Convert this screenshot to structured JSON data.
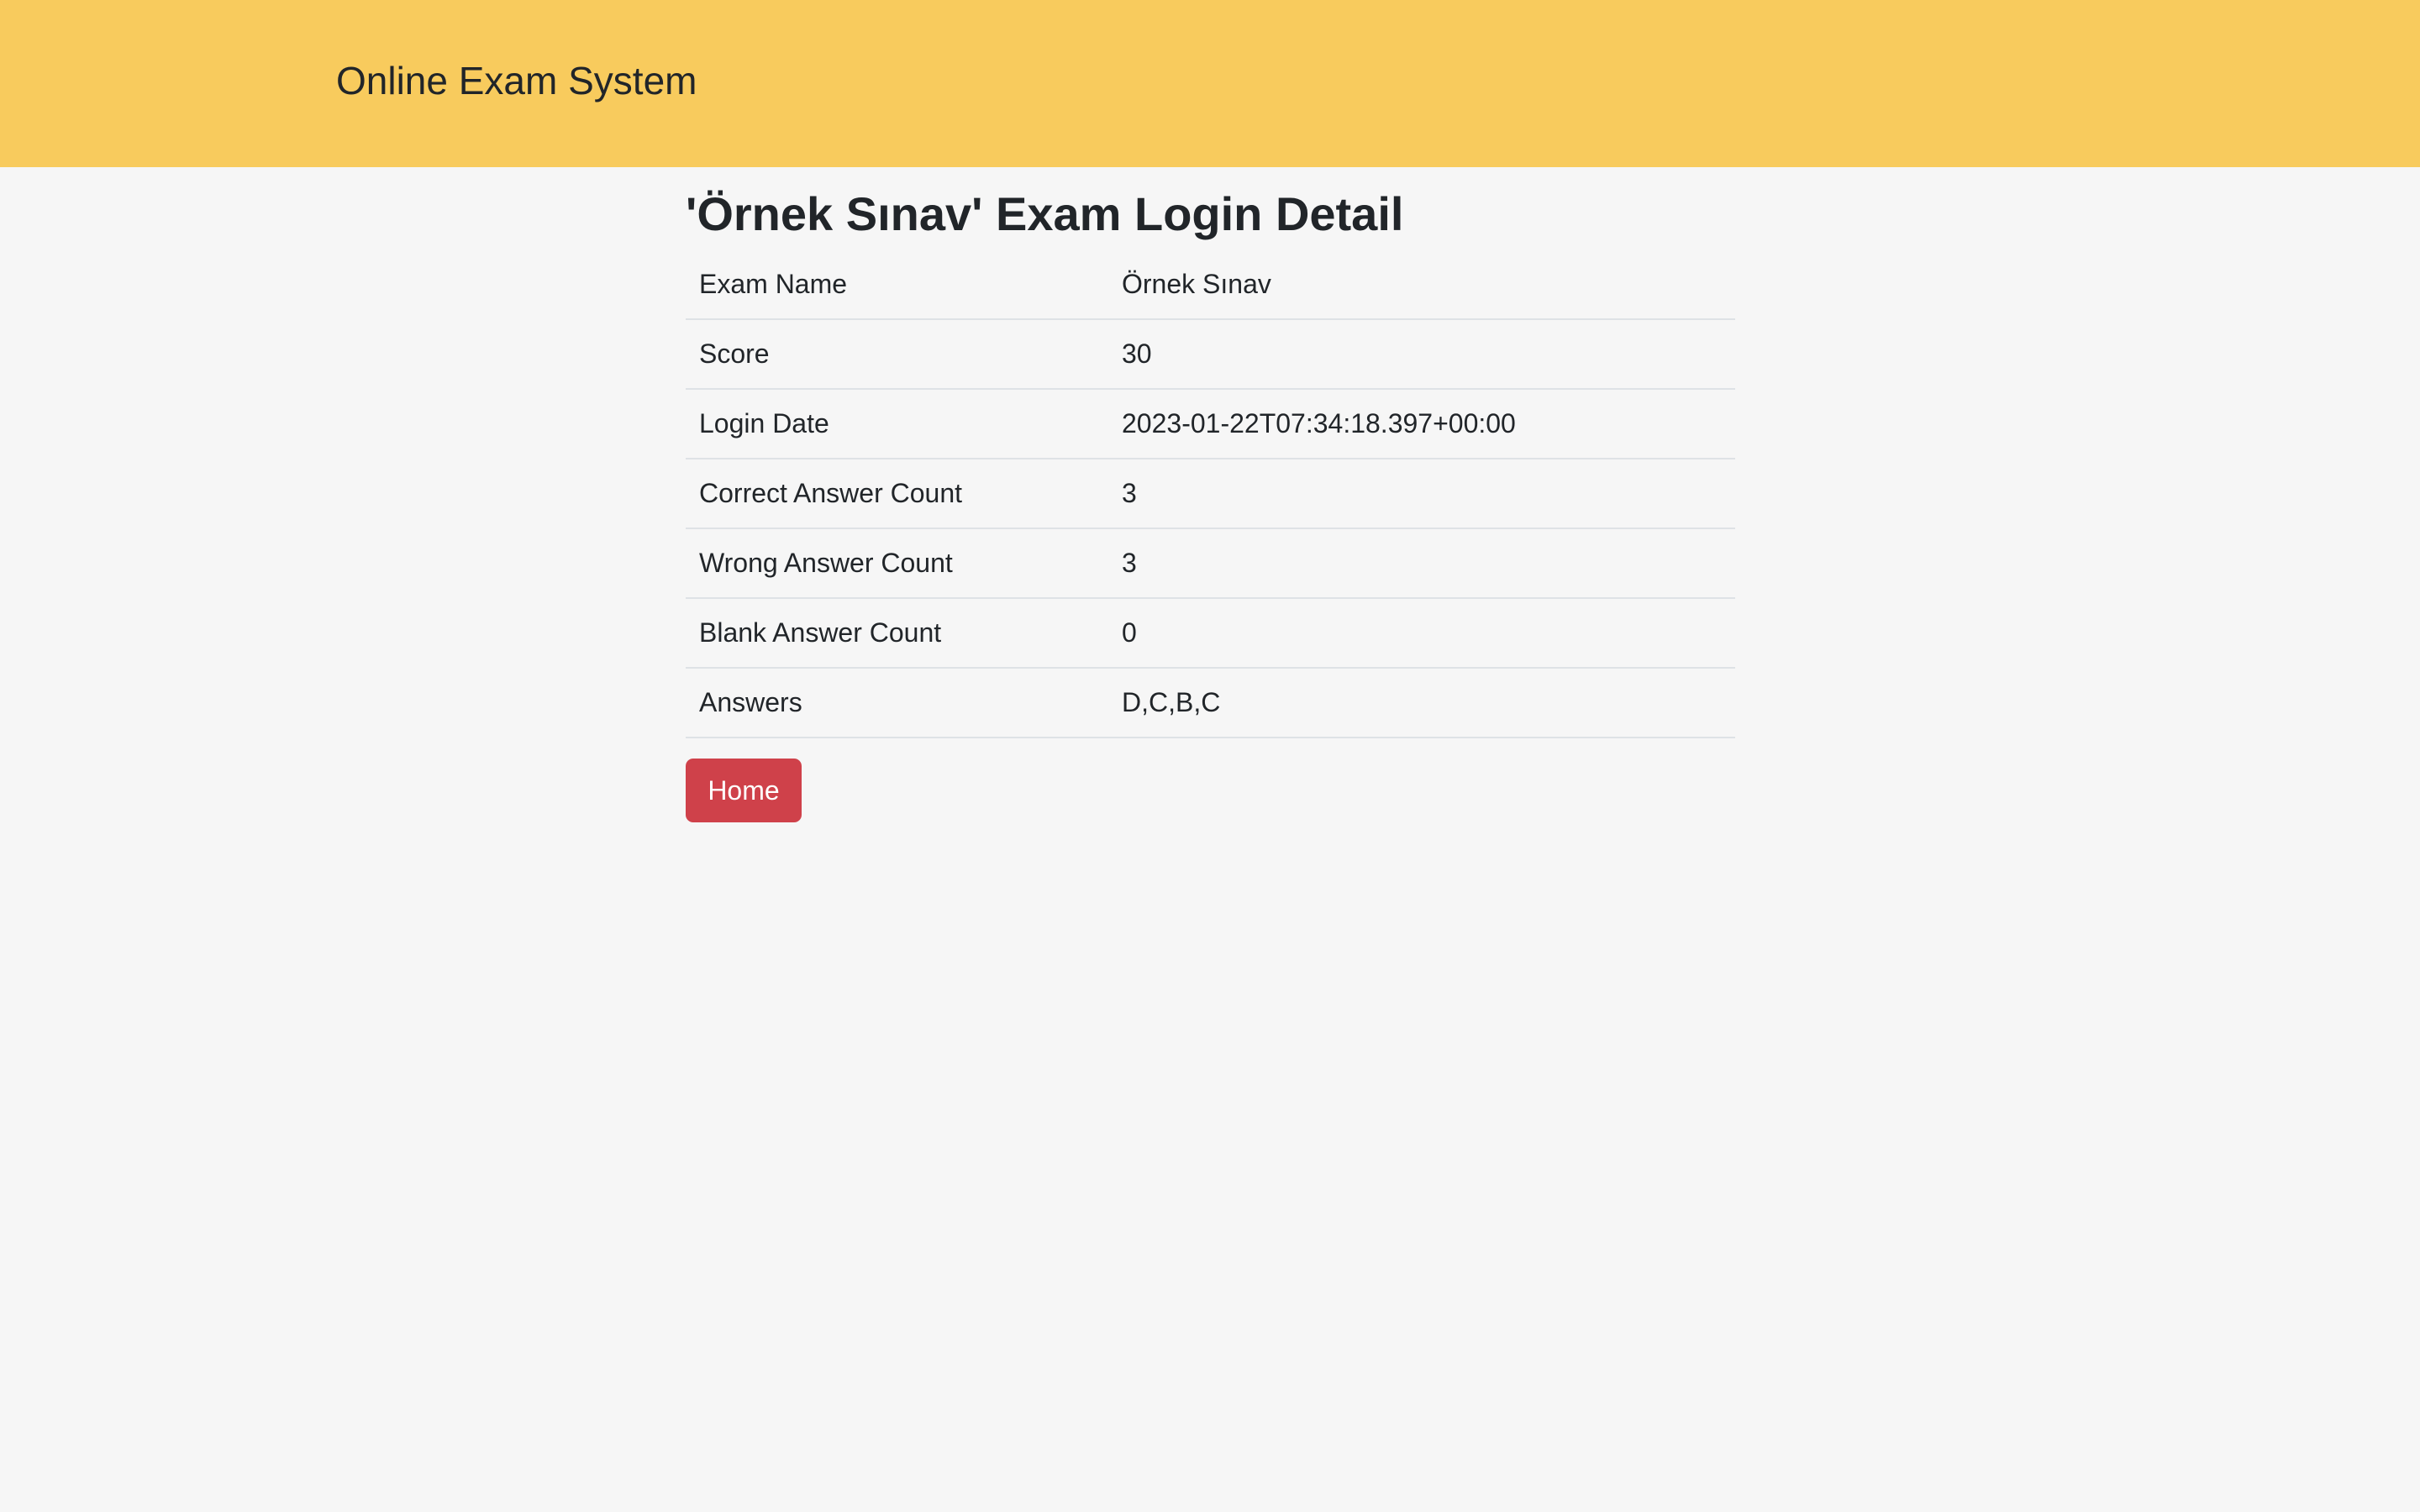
{
  "navbar": {
    "brand": "Online Exam System",
    "color": "#f8cb5d"
  },
  "page": {
    "title": "'Örnek Sınav' Exam Login Detail"
  },
  "details": {
    "rows": [
      {
        "label": "Exam Name",
        "value": "Örnek Sınav"
      },
      {
        "label": "Score",
        "value": "30"
      },
      {
        "label": "Login Date",
        "value": "2023-01-22T07:34:18.397+00:00"
      },
      {
        "label": "Correct Answer Count",
        "value": "3"
      },
      {
        "label": "Wrong Answer Count",
        "value": "3"
      },
      {
        "label": "Blank Answer Count",
        "value": "0"
      },
      {
        "label": "Answers",
        "value": "D,C,B,C"
      }
    ]
  },
  "actions": {
    "home_label": "Home",
    "home_color": "#cf414a"
  }
}
